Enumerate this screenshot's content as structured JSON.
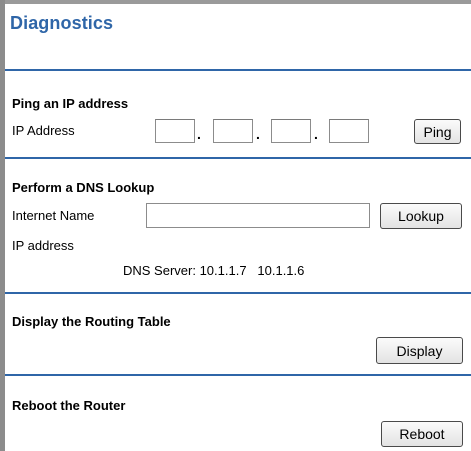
{
  "page": {
    "title": "Diagnostics"
  },
  "ping": {
    "heading": "Ping an IP address",
    "ip_label": "IP Address",
    "octets": [
      "",
      "",
      "",
      ""
    ],
    "separator": ".",
    "button_label": "Ping"
  },
  "dns": {
    "heading": "Perform a DNS Lookup",
    "name_label": "Internet Name",
    "name_value": "",
    "button_label": "Lookup",
    "ip_label": "IP address",
    "server_text": "DNS Server: 10.1.1.7   10.1.1.6"
  },
  "routing": {
    "heading": "Display the Routing Table",
    "button_label": "Display"
  },
  "reboot": {
    "heading": "Reboot the Router",
    "button_label": "Reboot"
  },
  "colors": {
    "accent": "#2f66a8",
    "frame": "#8c8c8c"
  }
}
